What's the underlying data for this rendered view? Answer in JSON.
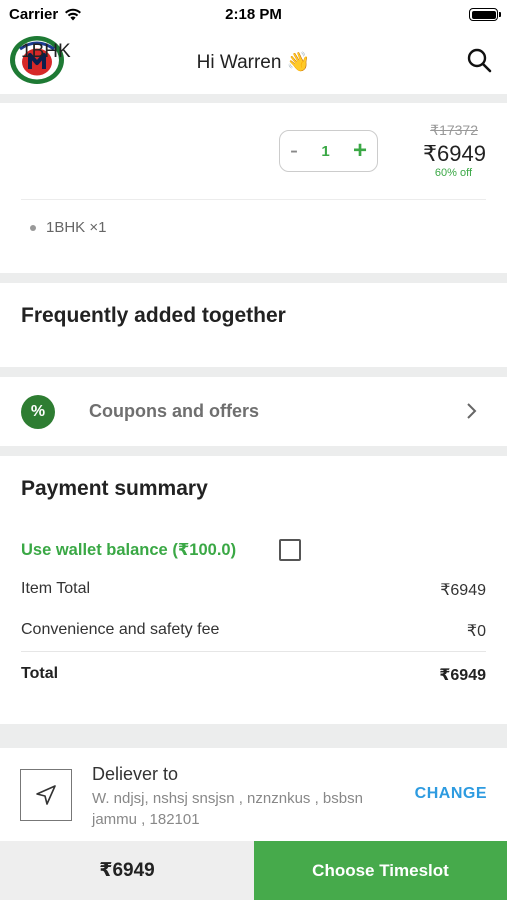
{
  "status_bar": {
    "carrier": "Carrier",
    "time": "2:18 PM"
  },
  "header": {
    "greeting": "Hi Warren 👋",
    "logo_text": "Metrofix"
  },
  "cart_item": {
    "name": "1BHK",
    "quantity": "1",
    "minus_label": "-",
    "plus_label": "+",
    "mrp": "₹17372",
    "price": "₹6949",
    "discount": "60% off",
    "sub_item": "1BHK ×1"
  },
  "frequently_added": {
    "title": "Frequently added together"
  },
  "coupons": {
    "label": "Coupons and offers",
    "icon_glyph": "%"
  },
  "payment_summary": {
    "title": "Payment summary",
    "wallet_label": "Use wallet balance (₹100.0)",
    "wallet_checked": false,
    "rows": [
      {
        "label": "Item Total",
        "value": "₹6949"
      },
      {
        "label": "Convenience and safety fee",
        "value": "₹0"
      }
    ],
    "total_label": "Total",
    "total_value": "₹6949"
  },
  "delivery": {
    "title": "Deliever to",
    "address": "W. ndjsj, nshsj snsjsn , nznznkus , bsbsn jammu , 182101",
    "change_label": "CHANGE"
  },
  "bottom_bar": {
    "total": "₹6949",
    "action_label": "Choose Timeslot"
  },
  "colors": {
    "accent_green": "#46aa4b",
    "link_blue": "#2d9be0",
    "coupon_icon": "#2e7d32"
  }
}
